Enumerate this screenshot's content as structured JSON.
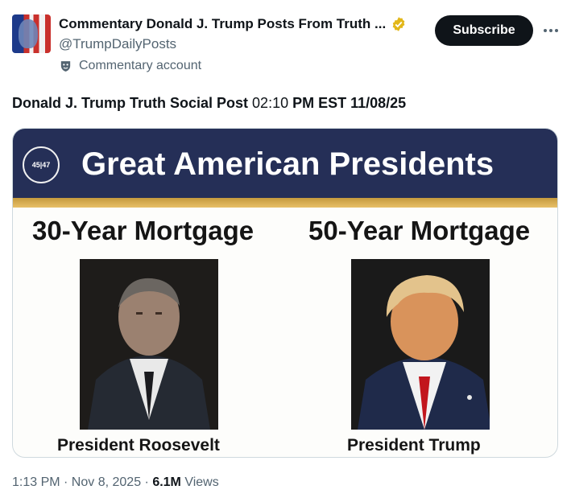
{
  "author": {
    "display_name": "Commentary Donald J. Trump Posts From Truth ...",
    "handle": "@TrumpDailyPosts",
    "account_label": "Commentary account"
  },
  "actions": {
    "subscribe_label": "Subscribe"
  },
  "post": {
    "text_bold_1": "Donald J. Trump Truth Social Post",
    "time": " 02:10 ",
    "text_bold_2": "PM EST 11/08/25"
  },
  "image": {
    "banner_title": "Great American Presidents",
    "seal_text": "45|47",
    "left_heading": "30-Year Mortgage",
    "right_heading": "50-Year Mortgage",
    "left_caption": "President Roosevelt",
    "right_caption": "President Trump"
  },
  "footer": {
    "timestamp": "1:13 PM · Nov 8, 2025 · ",
    "views_count": "6.1M",
    "views_label": " Views"
  },
  "colors": {
    "banner": "#252f57",
    "gold_stripe": "#c59a3e",
    "verified": "#e2b719"
  }
}
